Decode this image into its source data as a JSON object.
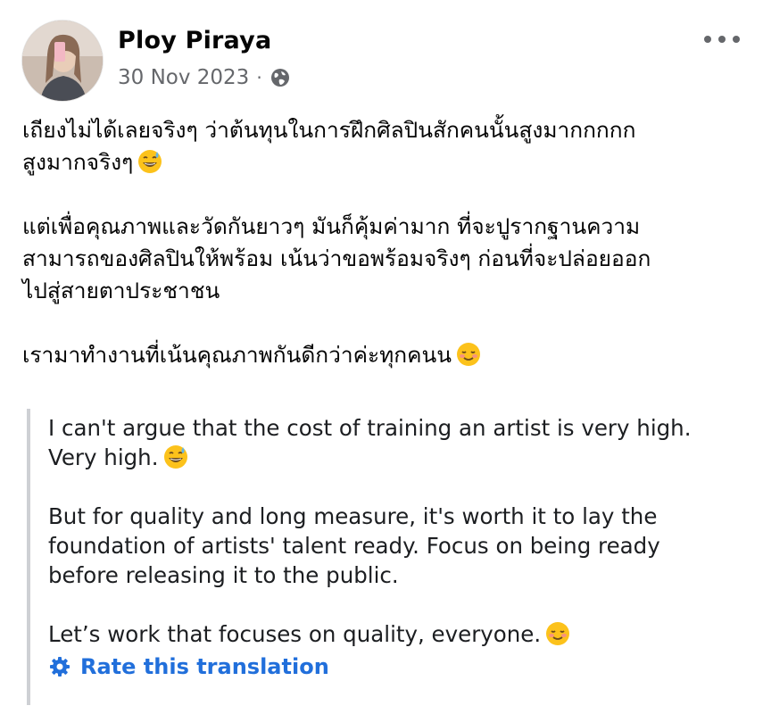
{
  "author": {
    "name": "Ploy Piraya",
    "date": "30 Nov 2023",
    "separator": "·",
    "audience_icon": "globe-icon"
  },
  "menu": {
    "icon": "more-horizontal-icon"
  },
  "post": {
    "paragraphs": [
      [
        "เถียงไม่ได้เลยจริงๆ ว่าต้นทุนในการฝึกศิลปินสักคนนั้นสูงมากกกกก",
        "สูงมากจริงๆ"
      ],
      [
        "แต่เพื่อคุณภาพและวัดกันยาวๆ มันก็คุ้มค่ามาก ที่จะปูรากฐานความ",
        "สามารถของศิลปินให้พร้อม เน้นว่าขอพร้อมจริงๆ ก่อนที่จะปล่อยออก",
        "ไปสู่สายตาประชาชน"
      ],
      [
        "เรามาทำงานที่เน้นคุณภาพกันดีกว่าค่ะทุกคนน"
      ]
    ],
    "emojis": [
      "grinning-sweat-emoji",
      "smiling-blush-emoji"
    ]
  },
  "translation": {
    "paragraphs": [
      [
        "I can't argue that the cost of training an artist is very high.",
        "Very high."
      ],
      [
        "But for quality and long measure, it's worth it to lay the",
        "foundation of artists' talent ready. Focus on being ready",
        "before releasing it to the public."
      ],
      [
        "Let’s work that focuses on quality, everyone."
      ]
    ],
    "rate_label": "Rate this translation",
    "rate_icon": "gear-icon",
    "link_color": "#216fdb"
  },
  "colors": {
    "text": "#050505",
    "secondary": "#65676b",
    "quote_bar": "#ced0d4"
  }
}
